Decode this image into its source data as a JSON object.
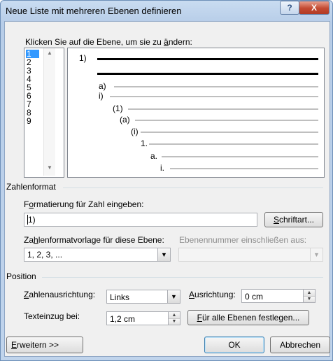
{
  "window": {
    "title": "Neue Liste mit mehreren Ebenen definieren",
    "help_glyph": "?",
    "close_glyph": "X"
  },
  "levels": {
    "label": "Klicken Sie auf die Ebene, um sie zu ändern:",
    "label_pre": "Klicken Sie auf die Ebene, um sie zu ",
    "label_ul": "ä",
    "label_post": "ndern:",
    "items": [
      "1",
      "2",
      "3",
      "4",
      "5",
      "6",
      "7",
      "8",
      "9"
    ],
    "selected": "1"
  },
  "preview": {
    "labels": [
      "1)",
      "a)",
      "i)",
      "(1)",
      "(a)",
      "(i)",
      "1.",
      "a.",
      "i."
    ]
  },
  "number_format": {
    "group_label": "Zahlenformat",
    "format_label_pre": "F",
    "format_label_ul": "o",
    "format_label_post": "rmatierung für Zahl eingeben:",
    "format_value": "1)",
    "font_button_ul": "S",
    "font_button_post": "chriftart...",
    "style_label_pre": "Za",
    "style_label_ul": "h",
    "style_label_post": "lenformatvorlage für diese Ebene:",
    "style_value": "1, 2, 3, ...",
    "include_label": "Ebenennummer einschließen aus:"
  },
  "position": {
    "group_label": "Position",
    "alignment_label_ul": "Z",
    "alignment_label_post": "ahlenausrichtung:",
    "alignment_value": "Links",
    "aligned_at_label_ul": "A",
    "aligned_at_label_post": "usrichtung:",
    "aligned_at_value": "0 cm",
    "indent_label_pre": "Texteinzu",
    "indent_label_ul": "g",
    "indent_label_post": " bei:",
    "indent_value": "1,2 cm",
    "set_all_button_ul": "F",
    "set_all_button_post": "ür alle Ebenen festlegen..."
  },
  "footer": {
    "more_button_ul": "E",
    "more_button_post": "rweitern >>",
    "ok_label": "OK",
    "cancel_label": "Abbrechen"
  }
}
